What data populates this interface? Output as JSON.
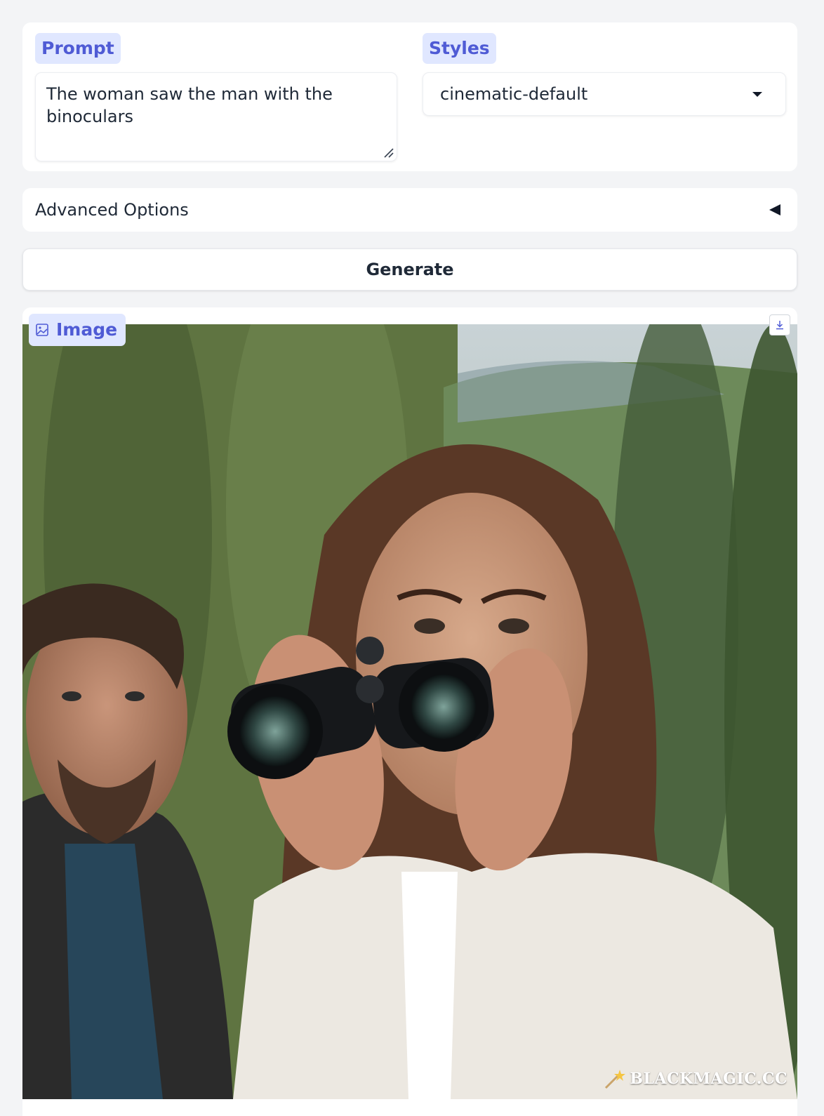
{
  "prompt": {
    "label": "Prompt",
    "value": "The woman saw the man with the binoculars"
  },
  "styles": {
    "label": "Styles",
    "selected": "cinematic-default"
  },
  "advanced": {
    "label": "Advanced Options"
  },
  "generate": {
    "label": "Generate"
  },
  "output": {
    "label": "Image",
    "watermark": "BLACKMAGIC.CC"
  },
  "colors": {
    "accent": "#4f5bd5",
    "chip_bg": "#e0e7ff",
    "page_bg": "#f3f4f6"
  },
  "icons": [
    "resize-grip-icon",
    "chevron-down-icon",
    "triangle-left-icon",
    "image-icon",
    "download-icon",
    "magic-wand-icon"
  ]
}
